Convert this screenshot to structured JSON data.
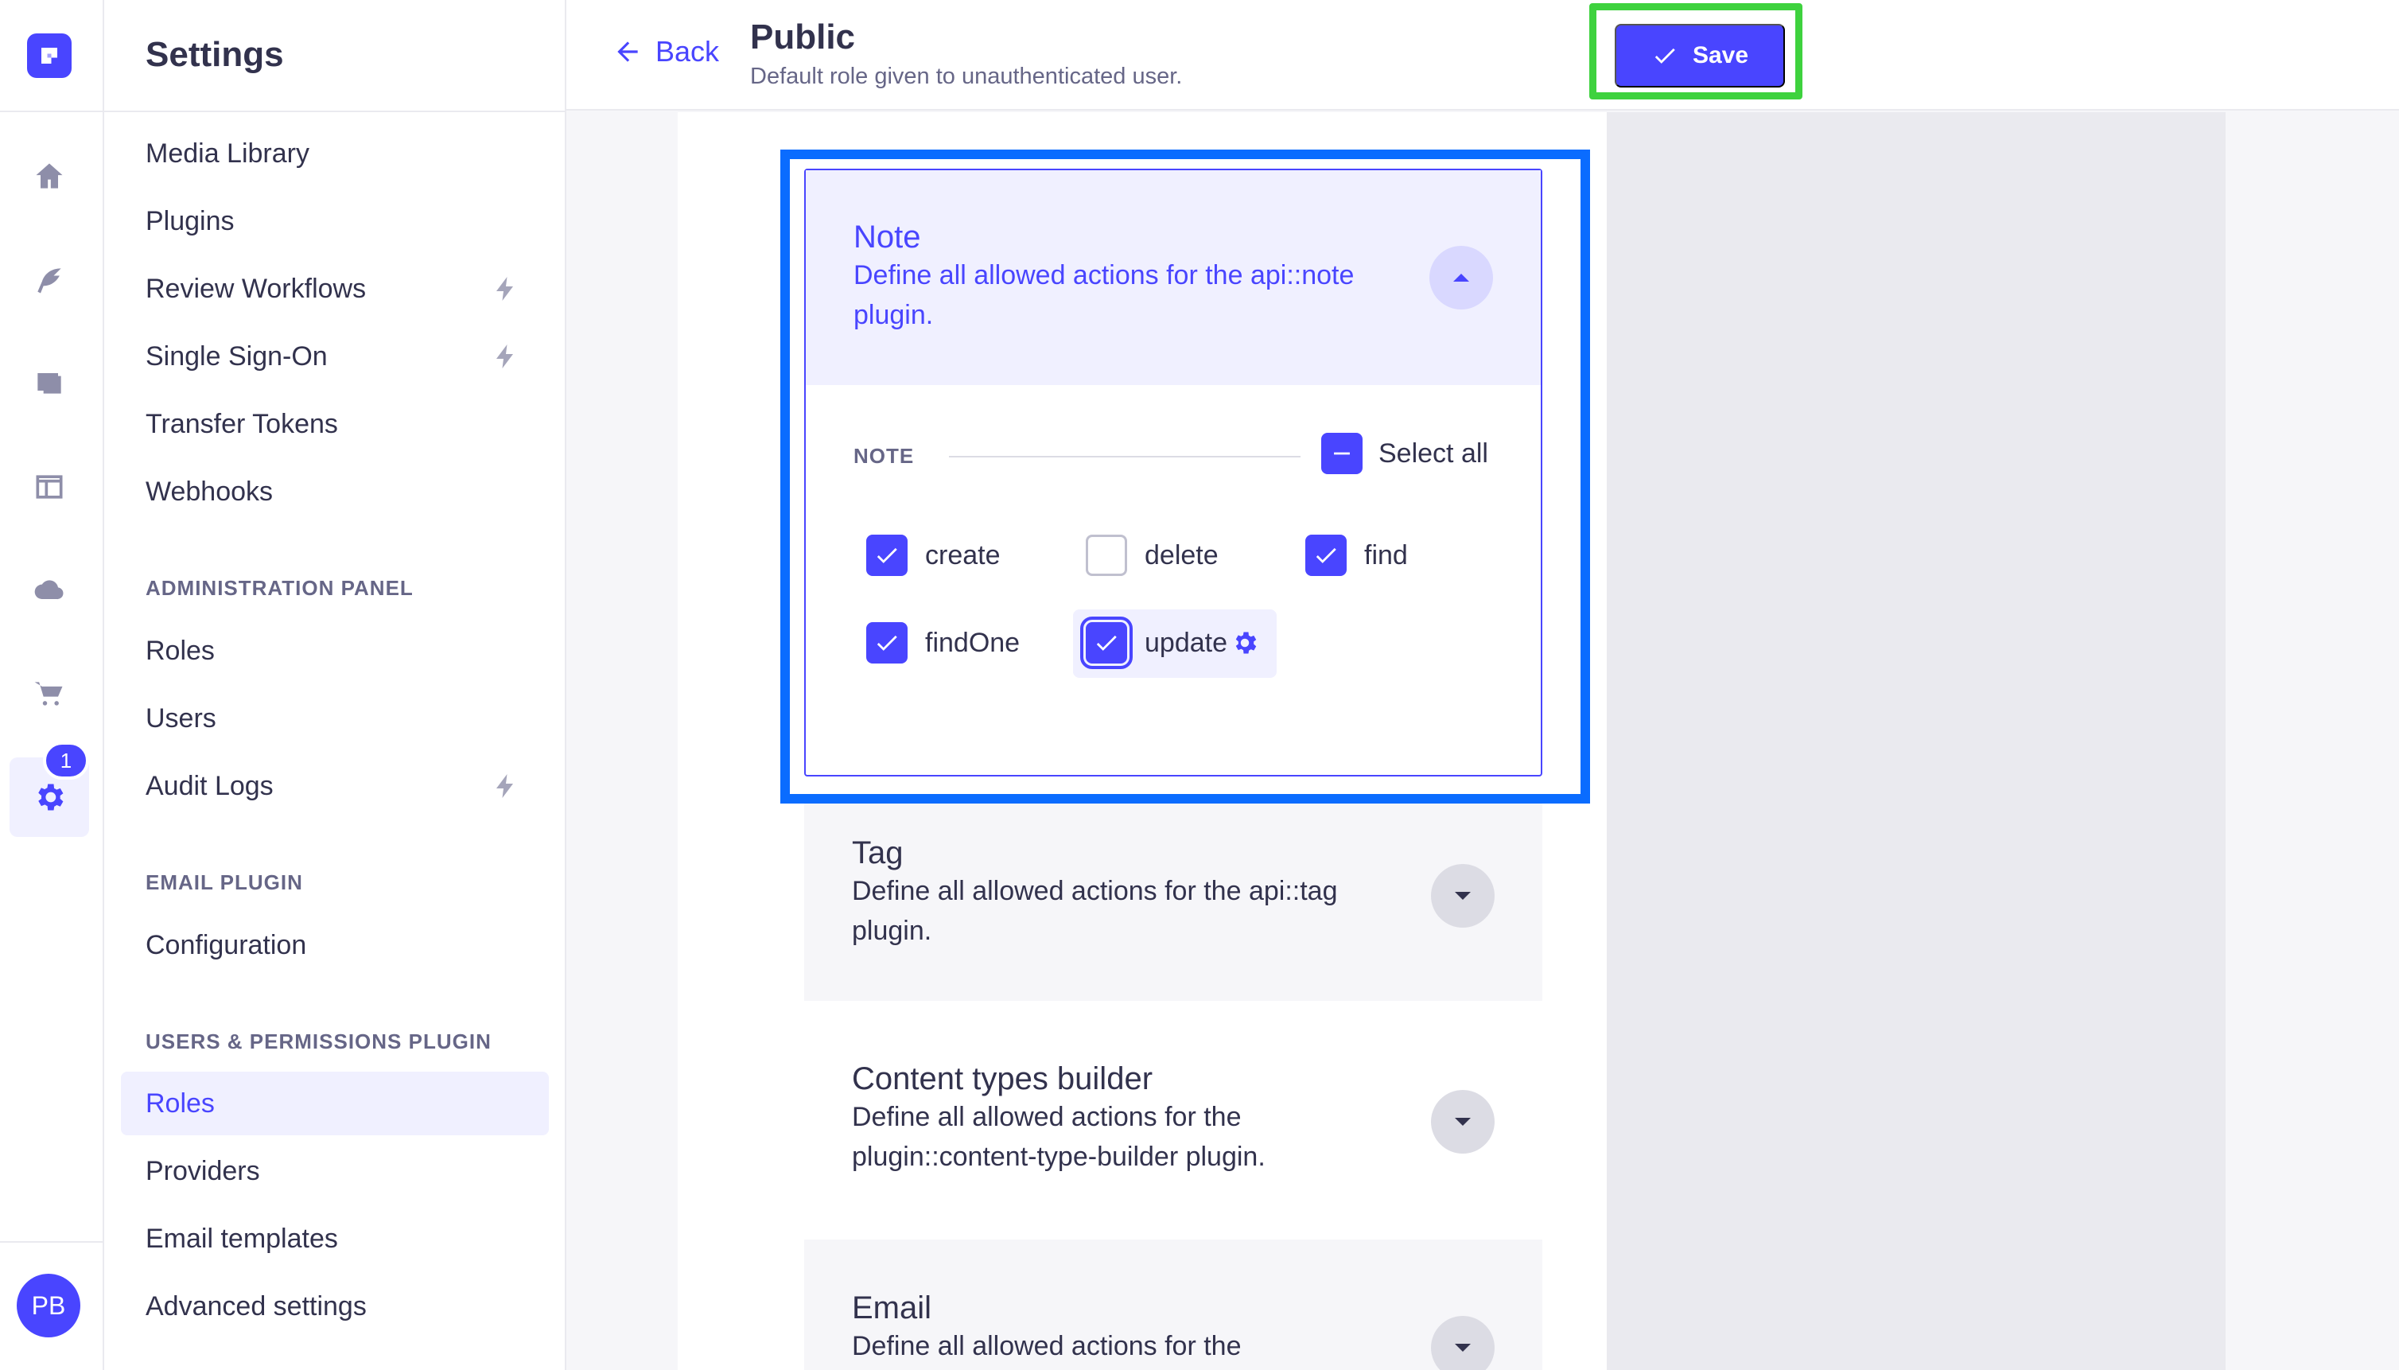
{
  "sidebar": {
    "title": "Settings",
    "items": [
      {
        "label": "Media Library",
        "premium": false
      },
      {
        "label": "Plugins",
        "premium": false
      },
      {
        "label": "Review Workflows",
        "premium": true
      },
      {
        "label": "Single Sign-On",
        "premium": true
      },
      {
        "label": "Transfer Tokens",
        "premium": false
      },
      {
        "label": "Webhooks",
        "premium": false
      }
    ],
    "sections": [
      {
        "title": "ADMINISTRATION PANEL",
        "items": [
          {
            "label": "Roles",
            "premium": false
          },
          {
            "label": "Users",
            "premium": false
          },
          {
            "label": "Audit Logs",
            "premium": true
          }
        ]
      },
      {
        "title": "EMAIL PLUGIN",
        "items": [
          {
            "label": "Configuration",
            "premium": false
          }
        ]
      },
      {
        "title": "USERS & PERMISSIONS PLUGIN",
        "items": [
          {
            "label": "Roles",
            "active": true
          },
          {
            "label": "Providers"
          },
          {
            "label": "Email templates"
          },
          {
            "label": "Advanced settings"
          }
        ]
      }
    ]
  },
  "rail": {
    "icons": [
      "home-icon",
      "feather-icon",
      "media-icon",
      "layout-icon",
      "cloud-icon",
      "cart-icon",
      "settings-icon"
    ],
    "active": "settings-icon",
    "settings_badge": "1",
    "user_initials": "PB"
  },
  "header": {
    "back_label": "Back",
    "title": "Public",
    "subtitle": "Default role given to unauthenticated user.",
    "save_label": "Save"
  },
  "permissions": {
    "open": {
      "title": "Note",
      "description": "Define all allowed actions for the api::note plugin.",
      "section_label": "NOTE",
      "select_all_label": "Select all",
      "select_all_state": "indeterminate",
      "actions": [
        {
          "label": "create",
          "checked": true
        },
        {
          "label": "delete",
          "checked": false
        },
        {
          "label": "find",
          "checked": true
        },
        {
          "label": "findOne",
          "checked": true
        },
        {
          "label": "update",
          "checked": true,
          "focused": true
        }
      ]
    },
    "closed": [
      {
        "title": "Tag",
        "description": "Define all allowed actions for the api::tag plugin."
      },
      {
        "title": "Content types builder",
        "description": "Define all allowed actions for the plugin::content-type-builder plugin."
      },
      {
        "title": "Email",
        "description": "Define all allowed actions for the"
      }
    ]
  },
  "colors": {
    "primary": "#4945ff",
    "highlight_frame_blue": "#0a6cff",
    "highlight_frame_green": "#3ed23e"
  }
}
